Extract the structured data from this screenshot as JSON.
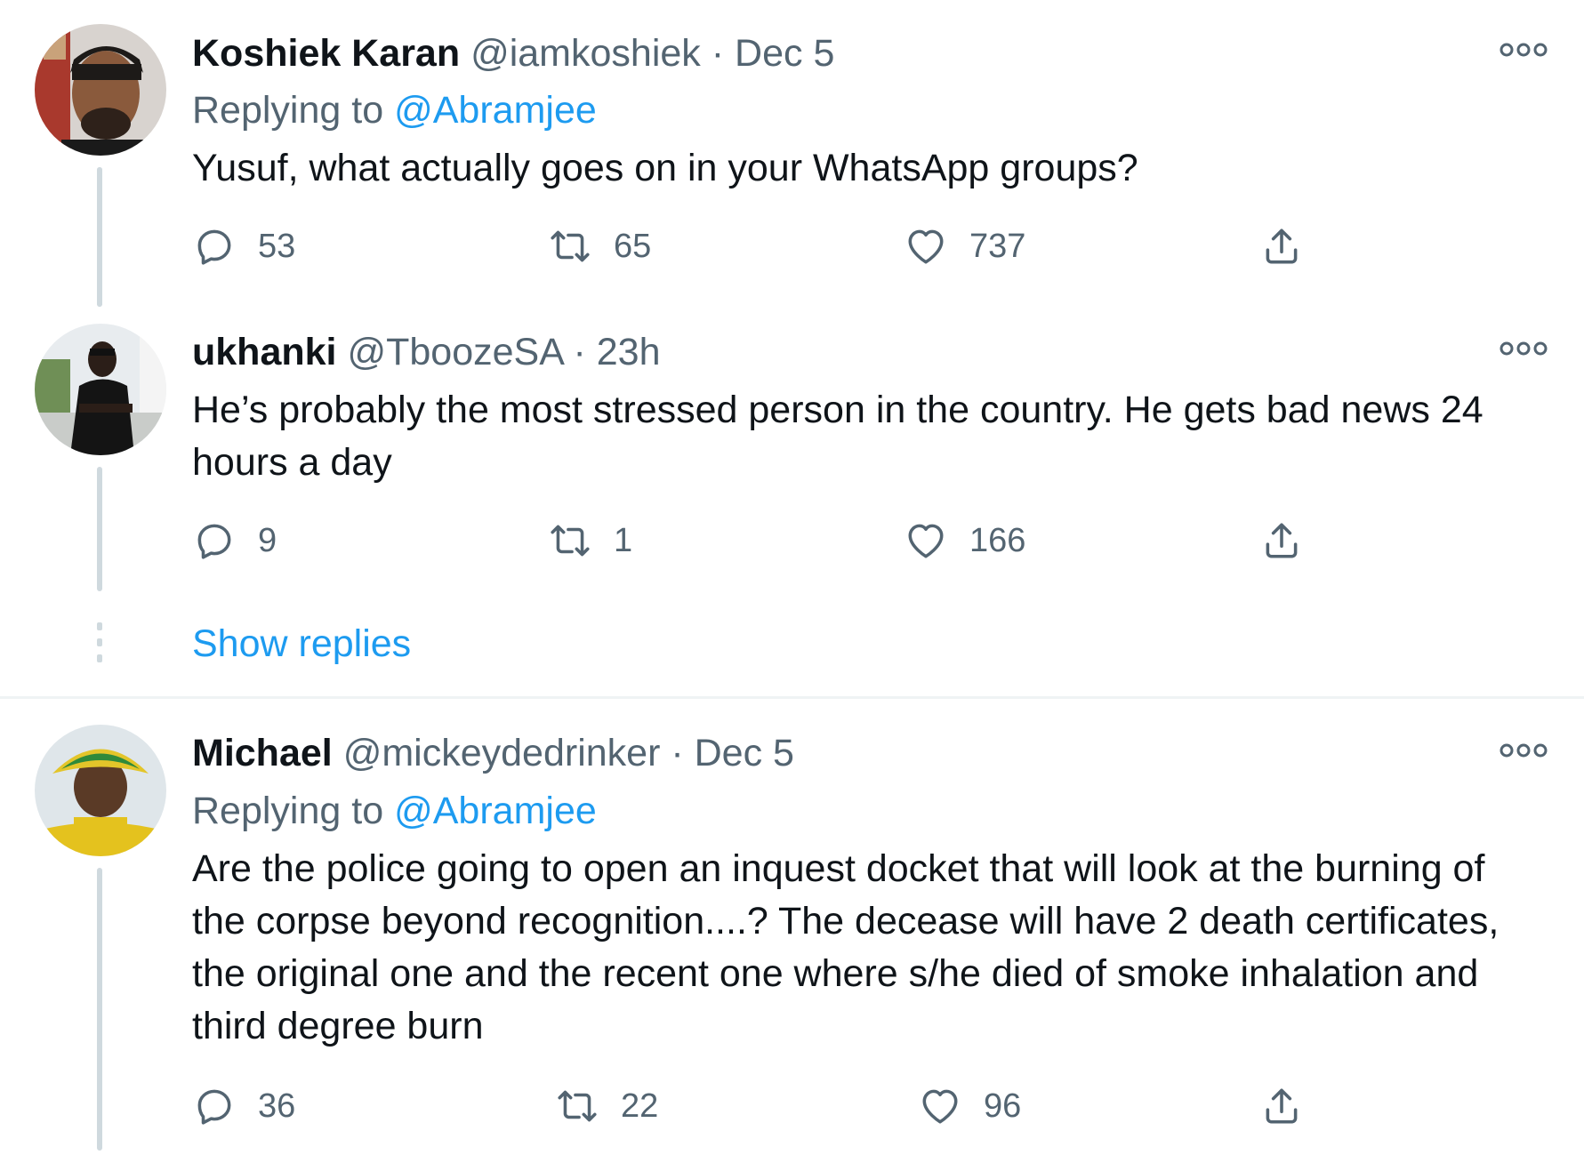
{
  "tweets": [
    {
      "name": "Koshiek Karan",
      "handle": "@iamkoshiek",
      "separator": "·",
      "time": "Dec 5",
      "replying_prefix": "Replying to",
      "replying_to": "@Abramjee",
      "text": "Yusuf, what actually goes on in your WhatsApp groups?",
      "replies": "53",
      "retweets": "65",
      "likes": "737"
    },
    {
      "name": "ukhanki",
      "handle": "@TboozeSA",
      "separator": "·",
      "time": "23h",
      "text": "He’s probably the most stressed person in the country. He gets bad news 24 hours a day",
      "replies": "9",
      "retweets": "1",
      "likes": "166"
    },
    {
      "name": "Michael",
      "handle": "@mickeydedrinker",
      "separator": "·",
      "time": "Dec 5",
      "replying_prefix": "Replying to",
      "replying_to": "@Abramjee",
      "text": "Are the police going to open an inquest docket that will look at the burning of the corpse beyond recognition....? The decease will have 2 death certificates, the original one and the recent one where s/he died of smoke inhalation and third degree burn",
      "replies": "36",
      "retweets": "22",
      "likes": "96"
    }
  ],
  "show_replies_label": "Show replies",
  "colors": {
    "text": "#0f1419",
    "secondary": "#536471",
    "link": "#1d9bf0",
    "thread_line": "#cfd9de",
    "divider": "#eff3f4"
  },
  "icons": [
    "more-options-icon",
    "reply-icon",
    "retweet-icon",
    "like-icon",
    "share-icon"
  ]
}
